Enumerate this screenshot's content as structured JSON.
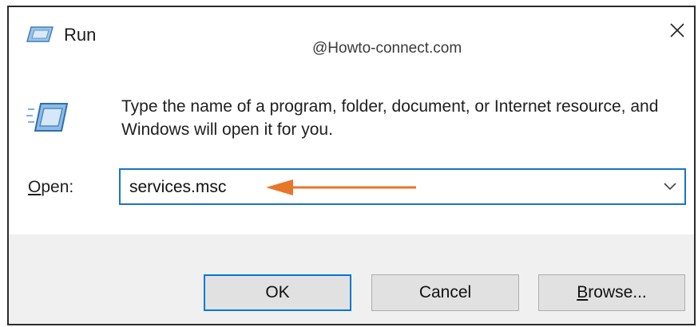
{
  "window": {
    "title": "Run",
    "watermark": "@Howto-connect.com",
    "close_label": "×"
  },
  "description": "Type the name of a program, folder, document, or Internet resource, and Windows will open it for you.",
  "open_field": {
    "label_access_key": "O",
    "label_rest": "pen:",
    "value": "services.msc"
  },
  "buttons": {
    "ok": "OK",
    "cancel": "Cancel",
    "browse_access_key": "B",
    "browse_rest": "rowse..."
  },
  "colors": {
    "accent": "#0078d7",
    "annotation_arrow": "#e8762a",
    "footer_bg": "#f0f0f0"
  },
  "icons": {
    "title": "run-icon",
    "body": "run-large-icon",
    "close": "close-icon",
    "dropdown": "chevron-down-icon",
    "annotation": "arrow-left-annotation"
  }
}
